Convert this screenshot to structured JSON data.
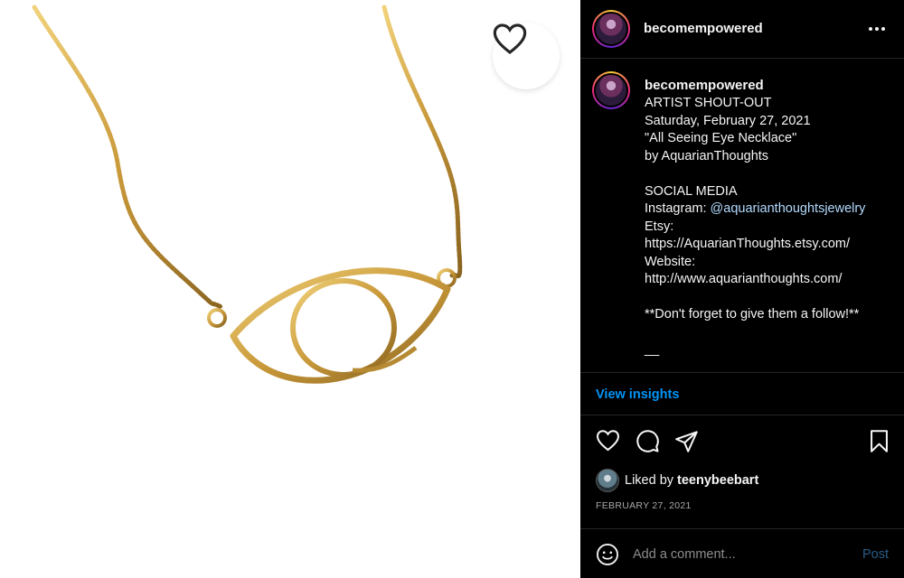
{
  "post": {
    "username": "becomempowered",
    "caption_lines": [
      "ARTIST SHOUT-OUT",
      "Saturday, February 27, 2021",
      "\"All Seeing Eye Necklace\"",
      "by AquarianThoughts",
      "",
      "SOCIAL MEDIA",
      "Instagram: ",
      "Etsy:",
      "https://AquarianThoughts.etsy.com/",
      "Website:",
      "http://www.aquarianthoughts.com/",
      "",
      "**Don't forget to give them a follow!**",
      "",
      "__"
    ],
    "mention": "@aquarianthoughtsjewelry",
    "insights_label": "View insights",
    "liked_prefix": "Liked by",
    "liked_user": "teenybeebart",
    "date": "FEBRUARY 27, 2021"
  },
  "comment": {
    "placeholder": "Add a comment...",
    "post_label": "Post"
  },
  "icons": {
    "header_more": "more-horizontal-icon",
    "photo_like": "heart-icon",
    "like": "heart-icon",
    "comment": "comment-bubble-icon",
    "share": "paper-plane-icon",
    "save": "bookmark-icon",
    "emoji": "smiley-icon"
  },
  "colors": {
    "panel_bg": "#000000",
    "link": "#0095f6",
    "mention": "#b3dbff",
    "muted": "#a8a8a8",
    "gold": "#c9993a"
  }
}
